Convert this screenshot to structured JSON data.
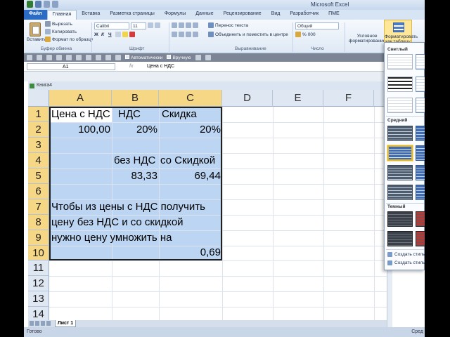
{
  "window": {
    "title": "Microsoft Excel"
  },
  "tabs": [
    "Файл",
    "Главная",
    "Вставка",
    "Разметка страницы",
    "Формулы",
    "Данные",
    "Рецензирование",
    "Вид",
    "Разработчик",
    "ПМЕ"
  ],
  "ribbon": {
    "clipboard": {
      "paste": "Вставить",
      "cut": "Вырезать",
      "copy": "Копировать",
      "format_painter": "Формат по образцу",
      "group": "Буфер обмена"
    },
    "font": {
      "name": "Calibri",
      "size": "11",
      "group": "Шрифт"
    },
    "alignment": {
      "wrap": "Перенос текста",
      "merge": "Объединить и поместить в центре",
      "group": "Выравнивание"
    },
    "number": {
      "format": "Общий",
      "percent": "%",
      "thousands": "000",
      "group": "Число"
    },
    "styles": {
      "conditional_line1": "Условное",
      "conditional_line2": "форматирование",
      "format_table_line1": "Форматировать",
      "format_table_line2": "как таблицу"
    }
  },
  "toolbar": {
    "auto": "Автоматически",
    "manual": "Вручную"
  },
  "formula_bar": {
    "name_box": "A1",
    "fx": "fx",
    "formula": "Цена с НДС"
  },
  "workbook": {
    "title": "Книга4"
  },
  "columns": [
    "A",
    "B",
    "C",
    "D",
    "E",
    "F"
  ],
  "rows": [
    "1",
    "2",
    "3",
    "4",
    "5",
    "6",
    "7",
    "8",
    "9",
    "10",
    "11",
    "12",
    "13",
    "14"
  ],
  "cells": {
    "a1": "Цена с НДС",
    "b1": "НДС",
    "c1": "Скидка",
    "a2": "100,00",
    "b2": "20%",
    "c2": "20%",
    "b4": "без НДС",
    "c4": "со Скидкой",
    "b5": "83,33",
    "c5": "69,44",
    "a7": "Чтобы из цены с НДС получить",
    "a8": "цену без НДС и со скидкой",
    "a9": "нужно цену умножить на",
    "c10": "0,69"
  },
  "sheet_tabs": [
    "Лист 1"
  ],
  "status": {
    "ready": "Готово",
    "right": "Сред"
  },
  "gallery": {
    "light": "Светлый",
    "medium": "Средний",
    "dark": "Темный",
    "new_table_style": "Создать стиль таблицы...",
    "new_pivot_style": "Создать стиль сводной таблицы..."
  }
}
